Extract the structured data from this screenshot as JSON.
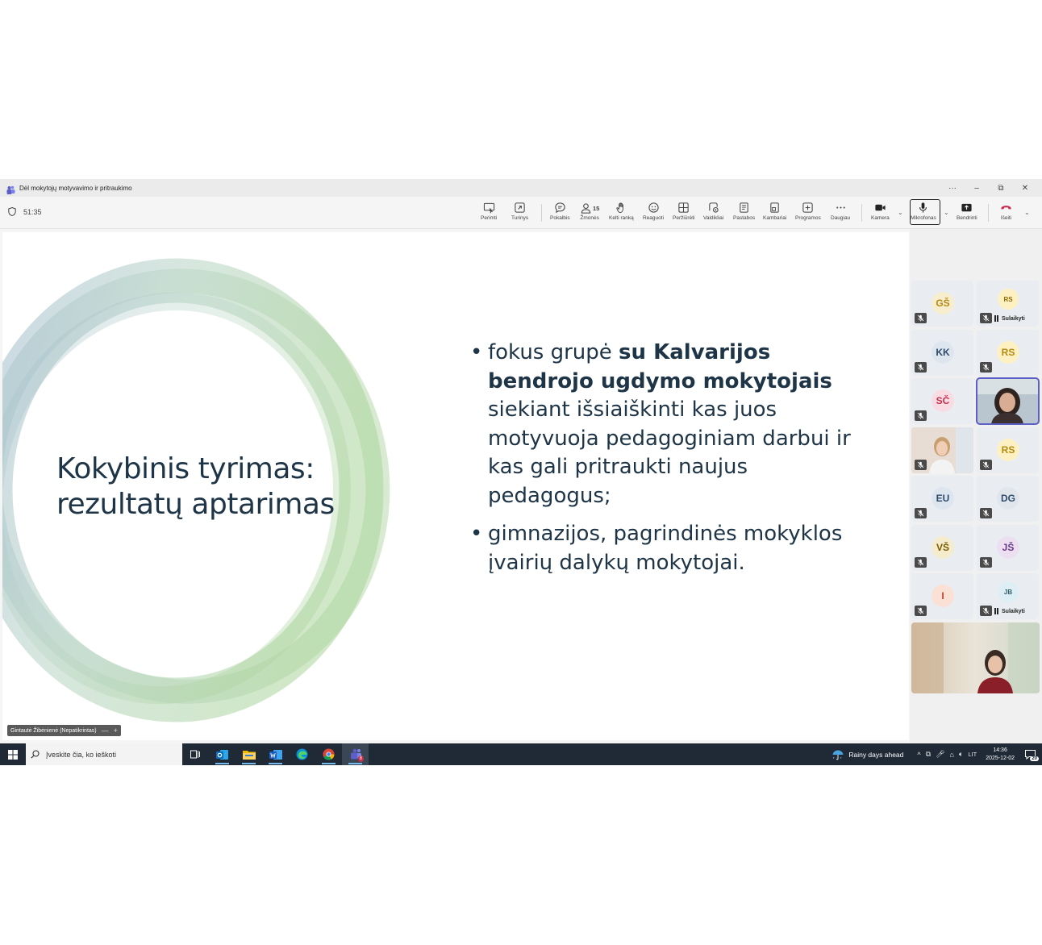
{
  "window": {
    "title": "Dėl mokytojų motyvavimo ir pritraukimo",
    "controls": [
      "···",
      "–",
      "⧉",
      "✕"
    ]
  },
  "meeting": {
    "timer": "51:35",
    "people_count": "15"
  },
  "toolbar": {
    "items": [
      {
        "label": "Perimti",
        "icon": "take-control-icon"
      },
      {
        "label": "Turinys",
        "icon": "content-icon"
      },
      {
        "label": "Pokalbis",
        "icon": "chat-icon"
      },
      {
        "label": "Žmonės",
        "icon": "people-icon"
      },
      {
        "label": "Kelti ranką",
        "icon": "raise-hand-icon"
      },
      {
        "label": "Reaguoti",
        "icon": "react-icon"
      },
      {
        "label": "Peržiūrėti",
        "icon": "view-icon"
      },
      {
        "label": "Valdikliai",
        "icon": "controls-icon"
      },
      {
        "label": "Pastabos",
        "icon": "notes-icon"
      },
      {
        "label": "Kambariai",
        "icon": "rooms-icon"
      },
      {
        "label": "Programos",
        "icon": "apps-icon"
      },
      {
        "label": "Daugiau",
        "icon": "more-icon"
      }
    ],
    "camera": "Kamera",
    "microphone": "Mikrofonas",
    "share": "Bendrinti",
    "leave": "Išeiti"
  },
  "slide": {
    "title_line1": "Kokybinis tyrimas:",
    "title_line2": "rezultatų aptarimas",
    "bullet1_pre": "fokus grupė ",
    "bullet1_bold": "su Kalvarijos bendrojo ugdymo mokytojais",
    "bullet1_post": " siekiant išsiaiškinti kas juos motyvuoja pedagoginiam darbui ir kas gali pritraukti naujus pedagogus;",
    "bullet2": "gimnazijos, pagrindinės mokyklos įvairių dalykų mokytojai."
  },
  "speaker_tag": {
    "name": "Gintautė Žibėnienė (Nepatikrintas)",
    "minus": "—",
    "plus": "+"
  },
  "participants": [
    {
      "initials": "GŠ",
      "bg": "#f6eecf",
      "fg": "#b58a10",
      "muted": true
    },
    {
      "initials": "RS",
      "bg": "#fdf1c4",
      "fg": "#8a6a00",
      "muted": true,
      "held": "Sulaikyti"
    },
    {
      "initials": "KK",
      "bg": "#dde5ef",
      "fg": "#2e4a6b",
      "muted": true
    },
    {
      "initials": "RS",
      "bg": "#fdf1c4",
      "fg": "#b58a10",
      "muted": true
    },
    {
      "initials": "SČ",
      "bg": "#f9dbe3",
      "fg": "#c2324f",
      "muted": true
    },
    {
      "initials": "",
      "video": true,
      "muted": false
    },
    {
      "initials": "",
      "video": true,
      "muted": true
    },
    {
      "initials": "RS",
      "bg": "#fdf1c4",
      "fg": "#b58a10",
      "muted": true
    },
    {
      "initials": "EU",
      "bg": "#dde5ef",
      "fg": "#2e4a6b",
      "muted": true
    },
    {
      "initials": "DG",
      "bg": "#e1e6ed",
      "fg": "#2e4a6b",
      "muted": true
    },
    {
      "initials": "VŠ",
      "bg": "#f4eccd",
      "fg": "#7a5b00",
      "muted": true
    },
    {
      "initials": "JŠ",
      "bg": "#ecdff2",
      "fg": "#6a3a85",
      "muted": true
    },
    {
      "initials": "I",
      "bg": "#fbe0d6",
      "fg": "#c2432f",
      "muted": true
    },
    {
      "initials": "JB",
      "bg": "#ddeef4",
      "fg": "#2e5f6b",
      "muted": true,
      "held": "Sulaikyti"
    }
  ],
  "taskbar": {
    "search_placeholder": "Įveskite čia, ko ieškoti",
    "apps": [
      "task-view-icon",
      "outlook-icon",
      "file-explorer-icon",
      "word-icon",
      "edge-icon",
      "chrome-icon",
      "teams-icon"
    ],
    "weather": "Rainy days ahead",
    "language": "LIT",
    "time": "14:36",
    "date": "2025-12-02",
    "notifications": "20",
    "teams_badge": "8"
  },
  "colors": {
    "accent": "#5b5fc7",
    "leave": "#c4314b",
    "slide_text": "#1e3447"
  }
}
